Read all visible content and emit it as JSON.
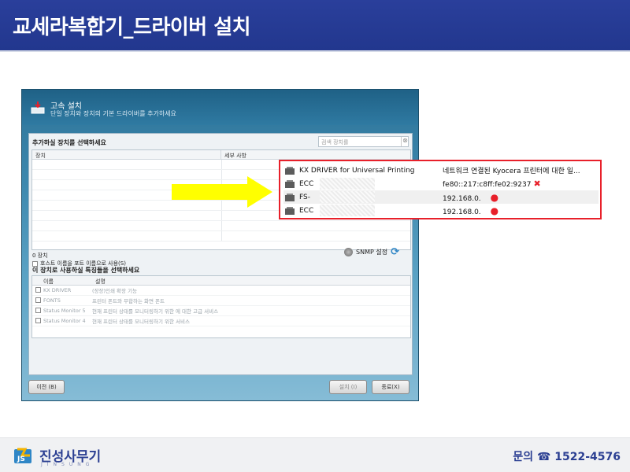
{
  "header": {
    "title": "교세라복합기_드라이버 설치"
  },
  "installer": {
    "title": "고속 설치",
    "subtitle": "단일 장치와 장치의 기본 드라이버를 추가하세요",
    "device_section_title": "추가하실 장치를 선택하세요",
    "search_placeholder": "검색 장치를",
    "columns": {
      "device": "장치",
      "details": "세부 사항"
    },
    "device_count": "0 장치",
    "host_option": "호스트 이름을 포트 이름으로 사용(S)",
    "snmp_label": "SNMP 설정",
    "feature_section_title": "이 장치로 사용하실 특징들을 선택하세요",
    "feature_columns": {
      "name": "이름",
      "desc": "설명"
    },
    "features": [
      {
        "name": "KX DRIVER",
        "desc": "(장장)인쇄 확장 기능"
      },
      {
        "name": "FONTS",
        "desc": "프린터 폰트와 무합하는 화면 폰트"
      },
      {
        "name": "Status Monitor 5",
        "desc": "현재 프린터 상태를 모니터링하기 위한 에 대한 고급 서비스"
      },
      {
        "name": "Status Monitor 4",
        "desc": "현재 프린터 상태를 모니터링하기 위한 서비스"
      }
    ],
    "buttons": {
      "back": "이전 (B)",
      "install": "설치 (I)",
      "exit": "종료(X)"
    }
  },
  "callout": {
    "rows": [
      {
        "name": "KX DRIVER for Universal Printing",
        "desc": "네트워크 연결된 Kyocera 프린터에 대한 일..."
      },
      {
        "name": "ECC",
        "desc": "fe80::217:c8ff:fe02:9237",
        "mark": "x"
      },
      {
        "name": "FS-",
        "desc": "192.168.0.",
        "mark": "dot"
      },
      {
        "name": "ECC",
        "desc": "192.168.0.",
        "mark": "dot"
      }
    ]
  },
  "footer": {
    "logo": "진성사무기",
    "logo_sub": "JINSUNG",
    "contact": "문의 ☎ 1522-4576"
  },
  "colors": {
    "header_bg": "#22378e",
    "callout_border": "#e8202a",
    "arrow": "#ffff00"
  }
}
